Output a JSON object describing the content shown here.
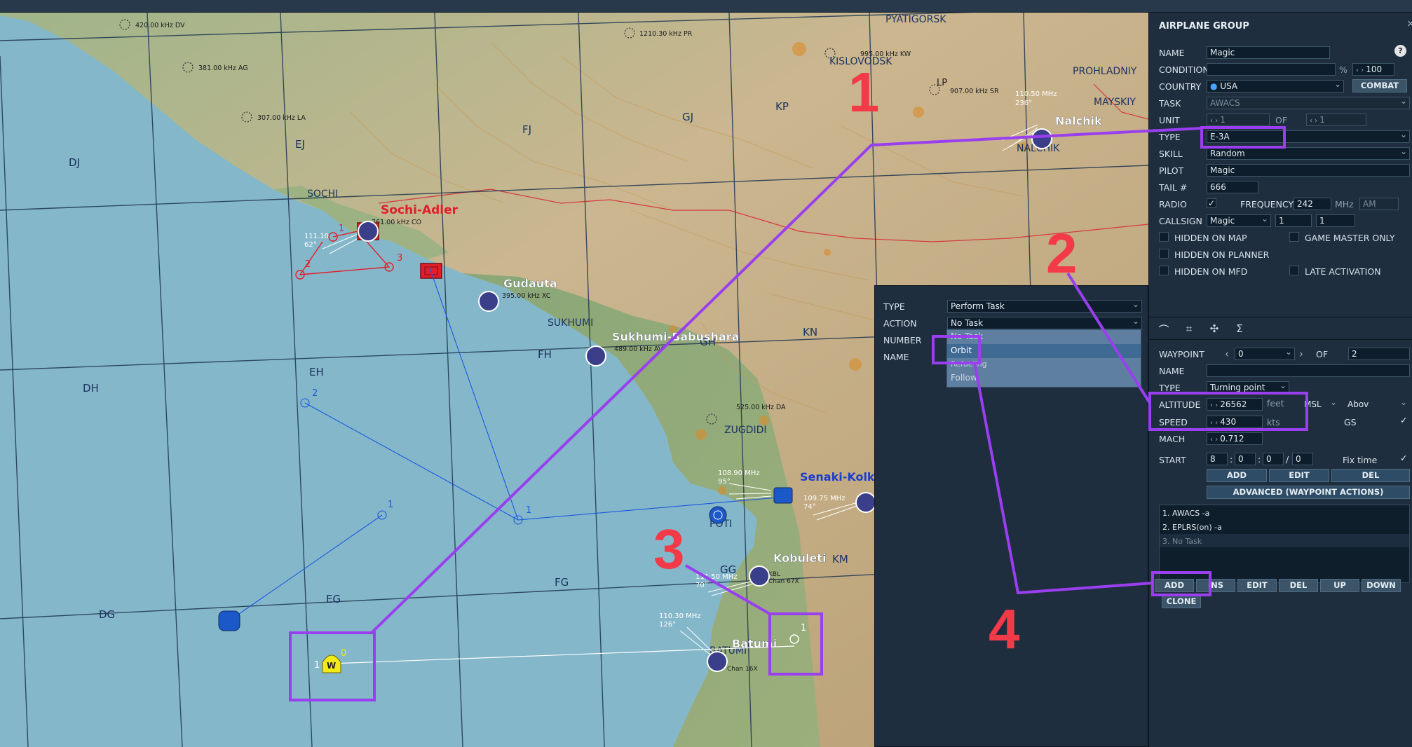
{
  "map": {
    "cities": [
      "PYATIGORSK",
      "KISLOVODSK",
      "PROHLADNIY",
      "MAYSKIY",
      "NALCHIK",
      "SOCHI",
      "SUKHUMI",
      "ZUGDIDI",
      "POTI",
      "BATUMI"
    ],
    "grid_labels": [
      "DJ",
      "EJ",
      "FJ",
      "GJ",
      "KP",
      "DH",
      "EH",
      "FH",
      "GH",
      "KN",
      "DG",
      "EG",
      "FG",
      "GG",
      "KM"
    ],
    "airfields": {
      "sochi": "Sochi-Adler",
      "gudauta": "Gudauta",
      "sukhumi": "Sukhumi-Babushara",
      "senaki": "Senaki-Kolk",
      "kobuleti": "Kobuleti",
      "batumi": "Batumi",
      "nalchik": "Nalchik"
    },
    "beacons": {
      "dv": "420.00 kHz DV",
      "pr": "1210.30 kHz PR",
      "ag": "381.00 kHz AG",
      "kw": "995.00 kHz KW",
      "la": "307.00 kHz LA",
      "sr": "907.00 kHz SR",
      "lp": "LP",
      "co": "761.00 kHz CO",
      "xc": "395.00 kHz XC",
      "da": "525.00 kHz DA",
      "av": "489.00 kHz AV",
      "nalchik_ils": "110.50 MHz",
      "nalchik_ils_hdg": "236°",
      "sochi_ils": "111.10",
      "sochi_ils_hdg": "62°",
      "senaki_ils": "108.90 MHz",
      "senaki_ils_hdg": "95°",
      "senaki_ils2": "109.75 MHz",
      "senaki_ils2_hdg": "74°",
      "kobuleti_ils": "111.50 MHz",
      "kobuleti_ils_hdg": "70°",
      "kobuleti_tcn": "Chan 67X",
      "kobuleti_id": "KBL",
      "batumi_ils": "110.30 MHz",
      "batumi_ils_hdg": "126°",
      "batumi_tcn": "Chan 16X"
    },
    "waypoints": {
      "red": [
        "1",
        "2",
        "3"
      ],
      "blue": [
        "1",
        "2"
      ],
      "group_wp0": "0",
      "group_wp1": "1",
      "group_start": "1",
      "mark_w": "W"
    }
  },
  "annotations": {
    "n1": "1",
    "n2": "2",
    "n3": "3",
    "n4": "4"
  },
  "group": {
    "title": "AIRPLANE GROUP",
    "help": "?",
    "name_label": "NAME",
    "name_value": "Magic",
    "condition_label": "CONDITION",
    "condition_value": "",
    "condition_pct": "%",
    "condition_num": "100",
    "country_label": "COUNTRY",
    "country_value": "USA",
    "combat": "COMBAT",
    "task_label": "TASK",
    "task_value": "AWACS",
    "unit_label": "UNIT",
    "unit_value": "1",
    "unit_of": "OF",
    "unit_total": "1",
    "type_label": "TYPE",
    "type_value": "E-3A",
    "skill_label": "SKILL",
    "skill_value": "Random",
    "pilot_label": "PILOT",
    "pilot_value": "Magic",
    "tail_label": "TAIL #",
    "tail_value": "666",
    "radio_label": "RADIO",
    "freq_label": "FREQUENCY",
    "freq_value": "242",
    "freq_unit": "MHz",
    "freq_mod": "AM",
    "callsign_label": "CALLSIGN",
    "callsign_value": "Magic",
    "callsign_n1": "1",
    "callsign_n2": "1",
    "hidden_map": "HIDDEN ON MAP",
    "game_master": "GAME MASTER ONLY",
    "hidden_planner": "HIDDEN ON PLANNER",
    "hidden_mfd": "HIDDEN ON MFD",
    "late_activation": "LATE ACTIVATION"
  },
  "waypoint": {
    "wp_label": "WAYPOINT",
    "wp_value": "0",
    "wp_of": "OF",
    "wp_total": "2",
    "name_label": "NAME",
    "name_value": "",
    "type_label": "TYPE",
    "type_value": "Turning point",
    "alt_label": "ALTITUDE",
    "alt_value": "26562",
    "alt_unit": "feet",
    "alt_ref": "MSL",
    "alt_ref2": "Abov",
    "speed_label": "SPEED",
    "speed_value": "430",
    "speed_unit": "kts",
    "gs": "GS",
    "mach_label": "MACH",
    "mach_value": "0.712",
    "start_label": "START",
    "start_d": "8",
    "start_h": "0",
    "start_m": "0",
    "start_s": "0",
    "fix_time": "Fix time",
    "add": "ADD",
    "edit": "EDIT",
    "del": "DEL",
    "advanced": "ADVANCED (WAYPOINT ACTIONS)",
    "tasks": [
      "1. AWACS -a",
      "2. EPLRS(on)  -a",
      "3. No Task"
    ],
    "t_add": "ADD",
    "t_ins": "INS",
    "t_edit": "EDIT",
    "t_del": "DEL",
    "t_up": "UP",
    "t_down": "DOWN",
    "t_clone": "CLONE"
  },
  "task_panel": {
    "type_label": "TYPE",
    "type_value": "Perform Task",
    "action_label": "ACTION",
    "action_value": "No Task",
    "number_label": "NUMBER",
    "name_label": "NAME",
    "options": [
      "No Task",
      "Orbit",
      "Refueling",
      "Follow"
    ]
  }
}
